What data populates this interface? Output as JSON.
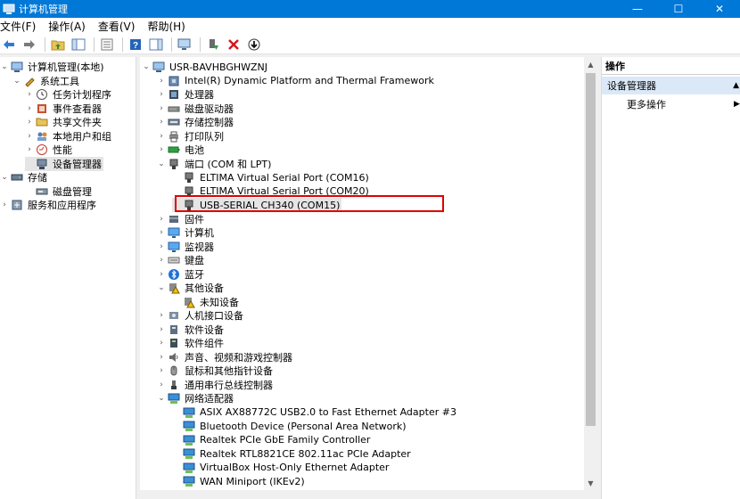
{
  "window": {
    "title": "计算机管理",
    "controls": [
      "—",
      "☐",
      "✕"
    ]
  },
  "menu": [
    "文件(F)",
    "操作(A)",
    "查看(V)",
    "帮助(H)"
  ],
  "left_tree": [
    {
      "label": "计算机管理(本地)",
      "indent": 0,
      "chevron": "⌄",
      "icon": "computer-mgmt-icon"
    },
    {
      "label": "系统工具",
      "indent": 1,
      "chevron": "⌄",
      "icon": "tools-icon"
    },
    {
      "label": "任务计划程序",
      "indent": 2,
      "chevron": "›",
      "icon": "clock-icon"
    },
    {
      "label": "事件查看器",
      "indent": 2,
      "chevron": "›",
      "icon": "event-viewer-icon"
    },
    {
      "label": "共享文件夹",
      "indent": 2,
      "chevron": "›",
      "icon": "shared-folder-icon"
    },
    {
      "label": "本地用户和组",
      "indent": 2,
      "chevron": "›",
      "icon": "users-icon"
    },
    {
      "label": "性能",
      "indent": 2,
      "chevron": "›",
      "icon": "performance-icon"
    },
    {
      "label": "设备管理器",
      "indent": 2,
      "chevron": "",
      "icon": "device-manager-icon",
      "selected": true
    },
    {
      "label": "存储",
      "indent": 0,
      "chevron": "⌄",
      "icon": "storage-icon"
    },
    {
      "label": "磁盘管理",
      "indent": 2,
      "chevron": "",
      "icon": "disk-mgmt-icon"
    },
    {
      "label": "服务和应用程序",
      "indent": 0,
      "chevron": "›",
      "icon": "services-icon"
    }
  ],
  "device_tree": [
    {
      "label": "USR-BAVHBGHWZNJ",
      "indent": 0,
      "chevron": "⌄",
      "icon": "computer-icon"
    },
    {
      "label": "Intel(R) Dynamic Platform and Thermal Framework",
      "indent": 1,
      "chevron": "›",
      "icon": "chip-icon"
    },
    {
      "label": "处理器",
      "indent": 1,
      "chevron": "›",
      "icon": "processor-icon"
    },
    {
      "label": "磁盘驱动器",
      "indent": 1,
      "chevron": "›",
      "icon": "disk-drive-icon"
    },
    {
      "label": "存储控制器",
      "indent": 1,
      "chevron": "›",
      "icon": "storage-controller-icon"
    },
    {
      "label": "打印队列",
      "indent": 1,
      "chevron": "›",
      "icon": "printer-icon"
    },
    {
      "label": "电池",
      "indent": 1,
      "chevron": "›",
      "icon": "battery-icon"
    },
    {
      "label": "端口 (COM 和 LPT)",
      "indent": 1,
      "chevron": "⌄",
      "icon": "port-icon"
    },
    {
      "label": "ELTIMA Virtual Serial Port (COM16)",
      "indent": 2,
      "chevron": "",
      "icon": "port-icon"
    },
    {
      "label": "ELTIMA Virtual Serial Port (COM20)",
      "indent": 2,
      "chevron": "",
      "icon": "port-icon"
    },
    {
      "label": "USB-SERIAL CH340 (COM15)",
      "indent": 2,
      "chevron": "",
      "icon": "port-icon",
      "selected": true
    },
    {
      "label": "固件",
      "indent": 1,
      "chevron": "›",
      "icon": "firmware-icon"
    },
    {
      "label": "计算机",
      "indent": 1,
      "chevron": "›",
      "icon": "monitor-icon"
    },
    {
      "label": "监视器",
      "indent": 1,
      "chevron": "›",
      "icon": "monitor-icon"
    },
    {
      "label": "键盘",
      "indent": 1,
      "chevron": "›",
      "icon": "keyboard-icon"
    },
    {
      "label": "蓝牙",
      "indent": 1,
      "chevron": "›",
      "icon": "bluetooth-icon"
    },
    {
      "label": "其他设备",
      "indent": 1,
      "chevron": "⌄",
      "icon": "other-devices-icon"
    },
    {
      "label": "未知设备",
      "indent": 2,
      "chevron": "",
      "icon": "unknown-device-icon"
    },
    {
      "label": "人机接口设备",
      "indent": 1,
      "chevron": "›",
      "icon": "hid-icon"
    },
    {
      "label": "软件设备",
      "indent": 1,
      "chevron": "›",
      "icon": "software-device-icon"
    },
    {
      "label": "软件组件",
      "indent": 1,
      "chevron": "›",
      "icon": "software-component-icon"
    },
    {
      "label": "声音、视频和游戏控制器",
      "indent": 1,
      "chevron": "›",
      "icon": "sound-icon"
    },
    {
      "label": "鼠标和其他指针设备",
      "indent": 1,
      "chevron": "›",
      "icon": "mouse-icon"
    },
    {
      "label": "通用串行总线控制器",
      "indent": 1,
      "chevron": "›",
      "icon": "usb-icon"
    },
    {
      "label": "网络适配器",
      "indent": 1,
      "chevron": "⌄",
      "icon": "network-icon"
    },
    {
      "label": "ASIX AX88772C USB2.0 to Fast Ethernet Adapter #3",
      "indent": 2,
      "chevron": "",
      "icon": "network-icon"
    },
    {
      "label": "Bluetooth Device (Personal Area Network)",
      "indent": 2,
      "chevron": "",
      "icon": "network-icon"
    },
    {
      "label": "Realtek PCIe GbE Family Controller",
      "indent": 2,
      "chevron": "",
      "icon": "network-icon"
    },
    {
      "label": "Realtek RTL8821CE 802.11ac PCIe Adapter",
      "indent": 2,
      "chevron": "",
      "icon": "network-icon"
    },
    {
      "label": "VirtualBox Host-Only Ethernet Adapter",
      "indent": 2,
      "chevron": "",
      "icon": "network-icon"
    },
    {
      "label": "WAN Miniport (IKEv2)",
      "indent": 2,
      "chevron": "",
      "icon": "network-icon"
    }
  ],
  "actions": {
    "header": "操作",
    "section": "设备管理器",
    "more": "更多操作"
  },
  "colors": {
    "titlebar": "#0078d7",
    "highlight_border": "#e00000",
    "selected": "#e5e5e5"
  }
}
